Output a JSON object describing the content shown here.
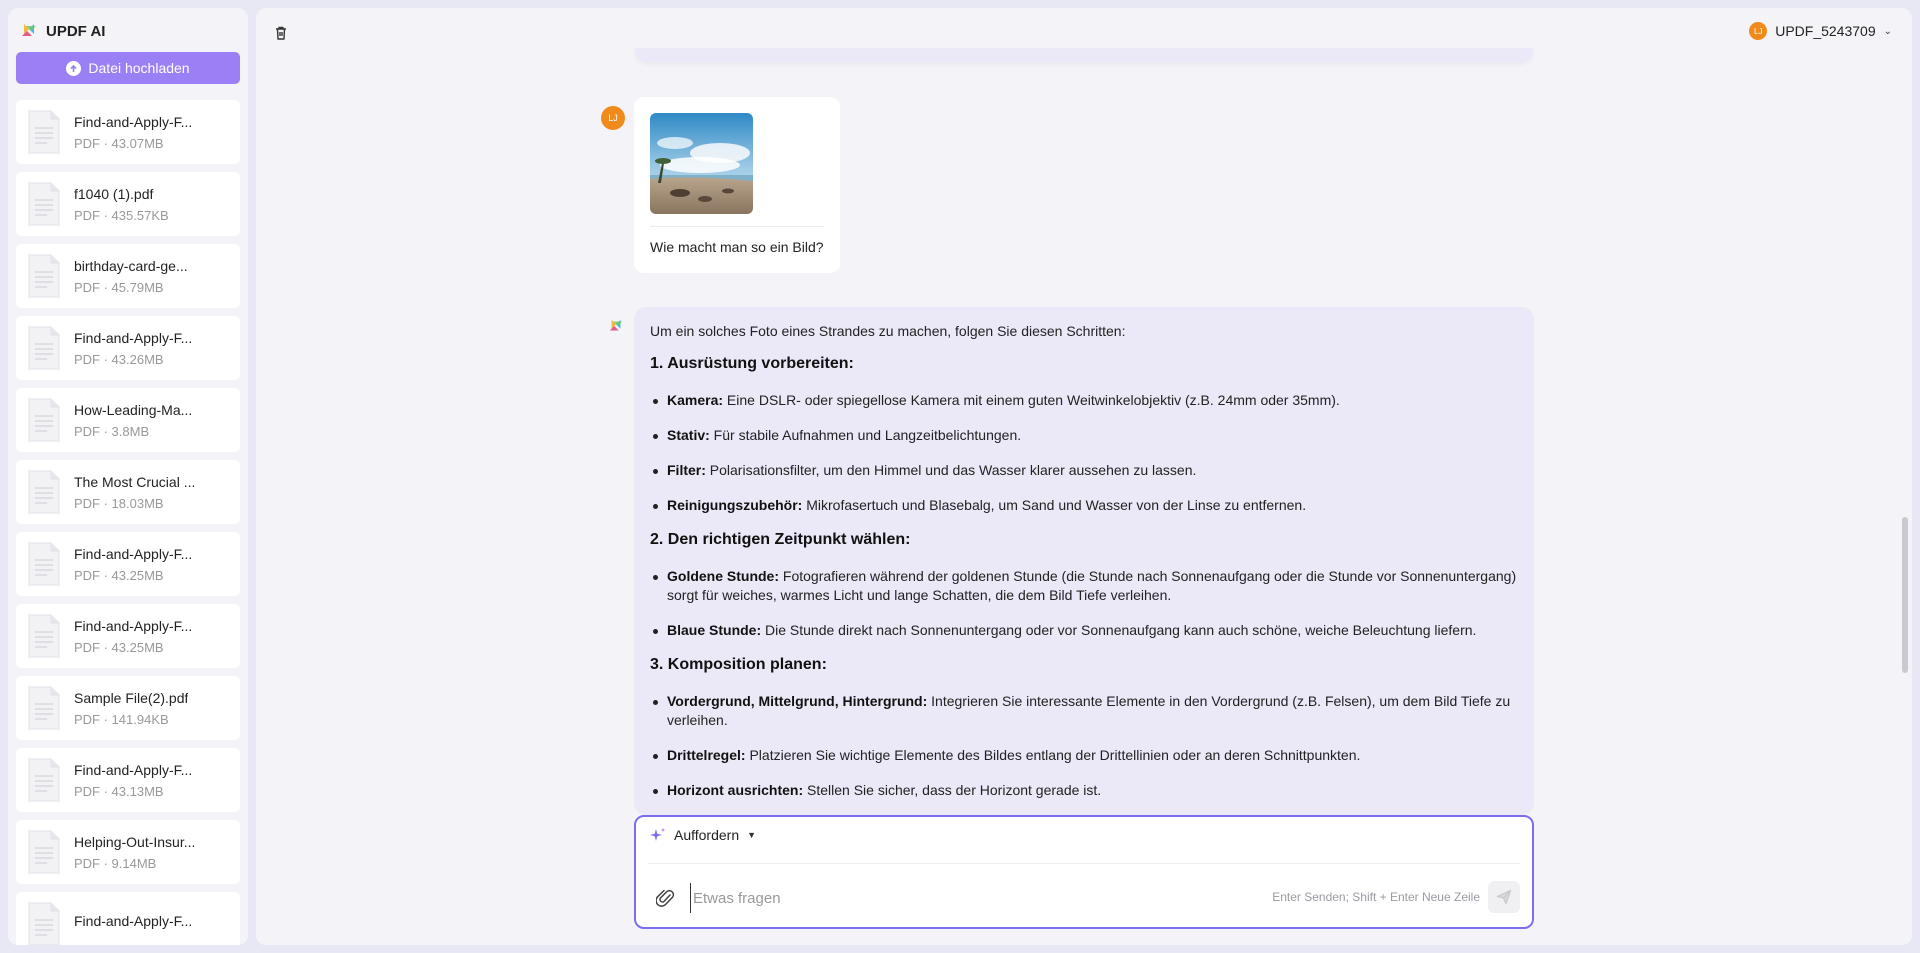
{
  "sidebar": {
    "brand": "UPDF AI",
    "upload_label": "Datei hochladen",
    "files": [
      {
        "name": "Find-and-Apply-F...",
        "size": "PDF · 43.07MB"
      },
      {
        "name": "f1040 (1).pdf",
        "size": "PDF · 435.57KB"
      },
      {
        "name": "birthday-card-ge...",
        "size": "PDF · 45.79MB"
      },
      {
        "name": "Find-and-Apply-F...",
        "size": "PDF · 43.26MB"
      },
      {
        "name": "How-Leading-Ma...",
        "size": "PDF · 3.8MB"
      },
      {
        "name": "The Most Crucial ...",
        "size": "PDF · 18.03MB"
      },
      {
        "name": "Find-and-Apply-F...",
        "size": "PDF · 43.25MB"
      },
      {
        "name": "Find-and-Apply-F...",
        "size": "PDF · 43.25MB"
      },
      {
        "name": "Sample File(2).pdf",
        "size": "PDF · 141.94KB"
      },
      {
        "name": "Find-and-Apply-F...",
        "size": "PDF · 43.13MB"
      },
      {
        "name": "Helping-Out-Insur...",
        "size": "PDF · 9.14MB"
      },
      {
        "name": "Find-and-Apply-F...",
        "size": ""
      }
    ]
  },
  "header": {
    "username": "UPDF_5243709",
    "avatar_initials": "LJ"
  },
  "chat": {
    "user_avatar": "LJ",
    "user_text": "Wie macht man so ein Bild?",
    "ai": {
      "intro": "Um ein solches Foto eines Strandes zu machen, folgen Sie diesen Schritten:",
      "sections": [
        {
          "heading": "1. Ausrüstung vorbereiten:",
          "items": [
            {
              "term": "Kamera:",
              "text": " Eine DSLR- oder spiegellose Kamera mit einem guten Weitwinkelobjektiv (z.B. 24mm oder 35mm)."
            },
            {
              "term": "Stativ:",
              "text": " Für stabile Aufnahmen und Langzeitbelichtungen."
            },
            {
              "term": "Filter:",
              "text": " Polarisationsfilter, um den Himmel und das Wasser klarer aussehen zu lassen."
            },
            {
              "term": "Reinigungszubehör:",
              "text": " Mikrofasertuch und Blasebalg, um Sand und Wasser von der Linse zu entfernen."
            }
          ]
        },
        {
          "heading": "2. Den richtigen Zeitpunkt wählen:",
          "items": [
            {
              "term": "Goldene Stunde:",
              "text": " Fotografieren während der goldenen Stunde (die Stunde nach Sonnenaufgang oder die Stunde vor Sonnenuntergang) sorgt für weiches, warmes Licht und lange Schatten, die dem Bild Tiefe verleihen."
            },
            {
              "term": "Blaue Stunde:",
              "text": " Die Stunde direkt nach Sonnenuntergang oder vor Sonnenaufgang kann auch schöne, weiche Beleuchtung liefern."
            }
          ]
        },
        {
          "heading": "3. Komposition planen:",
          "items": [
            {
              "term": "Vordergrund, Mittelgrund, Hintergrund:",
              "text": " Integrieren Sie interessante Elemente in den Vordergrund (z.B. Felsen), um dem Bild Tiefe zu verleihen."
            },
            {
              "term": "Drittelregel:",
              "text": " Platzieren Sie wichtige Elemente des Bildes entlang der Drittellinien oder an deren Schnittpunkten."
            },
            {
              "term": "Horizont ausrichten:",
              "text": " Stellen Sie sicher, dass der Horizont gerade ist."
            }
          ]
        }
      ]
    }
  },
  "composer": {
    "prompt_label": "Auffordern",
    "placeholder": "Etwas fragen",
    "hint": "Enter Senden; Shift + Enter Neue Zeile"
  },
  "colors": {
    "accent": "#9b7ff5",
    "border_active": "#7c6ef0",
    "ai_bubble": "#ebe8f8",
    "avatar": "#f08a1a"
  }
}
